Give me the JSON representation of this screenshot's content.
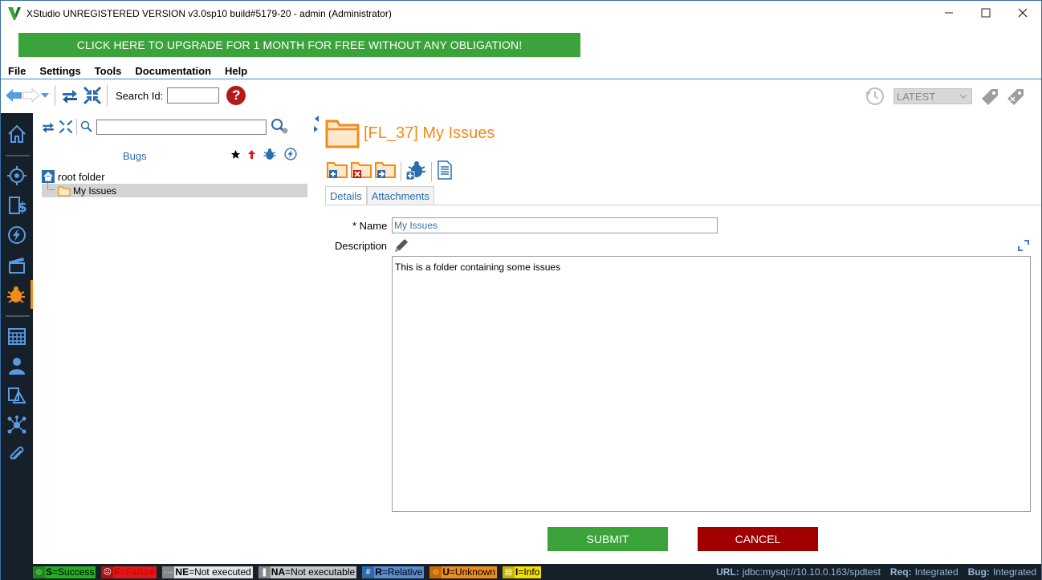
{
  "window": {
    "title": "XStudio UNREGISTERED VERSION v3.0sp10 build#5179-20 - admin (Administrator)",
    "minimize": "—",
    "maximize": "☐",
    "close": "✕"
  },
  "banner": {
    "text": "CLICK HERE TO UPGRADE FOR 1 MONTH FOR FREE WITHOUT ANY OBLIGATION!"
  },
  "menu": {
    "items": [
      "File",
      "Settings",
      "Tools",
      "Documentation",
      "Help"
    ]
  },
  "toolbar": {
    "search_label": "Search Id:",
    "search_value": "",
    "help_label": "?",
    "version_select": "LATEST"
  },
  "tree": {
    "tab_label": "Bugs",
    "search_value": "",
    "root_label": "root folder",
    "child_label": "My Issues"
  },
  "detail": {
    "title": "[FL_37] My Issues",
    "tabs": [
      "Details",
      "Attachments"
    ],
    "name_label": "* Name",
    "name_value": "My Issues",
    "description_label": "Description",
    "description_value": "This is a folder containing some issues",
    "submit_label": "SUBMIT",
    "cancel_label": "CANCEL"
  },
  "legend": [
    {
      "key": "S",
      "text": "=Success",
      "bg": "#22b022",
      "fg": "#000"
    },
    {
      "key": "F",
      "text": "=Failure",
      "bg": "#e01818",
      "fg": "#c00"
    },
    {
      "key": "NE",
      "text": "=Not executed",
      "bg": "#e6e6e6",
      "fg": "#000"
    },
    {
      "key": "NA",
      "text": "=Not executable",
      "bg": "#c8c8c8",
      "fg": "#000"
    },
    {
      "key": "R",
      "text": "=Relative",
      "bg": "#5a8ad0",
      "fg": "#000"
    },
    {
      "key": "U",
      "text": "=Unknown",
      "bg": "#f08c1a",
      "fg": "#000"
    },
    {
      "key": "I",
      "text": "=Info",
      "bg": "#f5e000",
      "fg": "#000"
    }
  ],
  "status": {
    "url_label": "URL:",
    "url_value": "jdbc:mysql://10.10.0.163/spdtest",
    "req_label": "Req:",
    "req_value": "Integrated",
    "bug_label": "Bug:",
    "bug_value": "Integrated"
  },
  "colors": {
    "accent_orange": "#f08c1a",
    "success_green": "#3aa43a",
    "cancel_red": "#a00000",
    "nav_dark": "#16202a",
    "link_blue": "#2b6cb0"
  }
}
